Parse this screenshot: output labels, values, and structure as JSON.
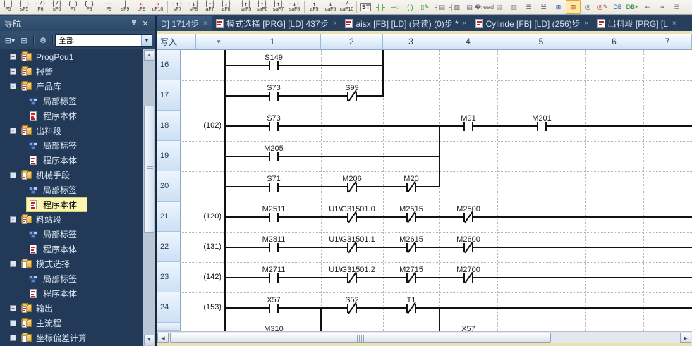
{
  "toolbar": {
    "groups": [
      [
        {
          "sym": "┤ ├",
          "label": "F5"
        },
        {
          "sym": "┤ ├",
          "label": "sF5"
        },
        {
          "sym": "┤/├",
          "label": "F6"
        },
        {
          "sym": "┤/├",
          "label": "sF6"
        },
        {
          "sym": "( )",
          "label": "F7"
        },
        {
          "sym": "{ }",
          "label": "F8"
        }
      ],
      [
        {
          "sym": "──",
          "label": "F9"
        },
        {
          "sym": "│",
          "label": "sF9"
        },
        {
          "sym": "✕",
          "label": "cF9",
          "red": true
        },
        {
          "sym": "✕",
          "label": "cF10",
          "red": true
        }
      ],
      [
        {
          "sym": "┤↑├",
          "label": "sF7"
        },
        {
          "sym": "┤↓├",
          "label": "sF8"
        },
        {
          "sym": "┤↑├",
          "label": "aF7"
        },
        {
          "sym": "┤↓├",
          "label": "aF8"
        }
      ],
      [
        {
          "sym": "┤↑├",
          "label": "saF5"
        },
        {
          "sym": "┤↑├",
          "label": "saF6"
        },
        {
          "sym": "┤↑├",
          "label": "saF7"
        },
        {
          "sym": "┤↓├",
          "label": "saF8"
        }
      ],
      [
        {
          "sym": "↑",
          "label": "aF5"
        },
        {
          "sym": "↓",
          "label": "caF5"
        },
        {
          "sym": "─/─",
          "label": "caF10"
        }
      ]
    ],
    "icons": [
      {
        "name": "st-editor-icon",
        "glyph": "ST",
        "boxed": true
      },
      {
        "name": "edit-contact-icon",
        "glyph": "┤├",
        "color": "#2e8b2e"
      },
      {
        "name": "edit-branch-icon",
        "glyph": "─○",
        "color": "#2e8b2e"
      },
      {
        "name": "edit-coil-icon",
        "glyph": "( )",
        "color": "#2e8b2e"
      },
      {
        "name": "edit-block-icon",
        "glyph": "▯✎",
        "color": "#2e8b2e"
      },
      {
        "name": "device-comment-icon",
        "glyph": "┤▤",
        "color": "#667"
      },
      {
        "name": "note-edit-icon",
        "glyph": "┤▥",
        "color": "#667"
      },
      {
        "name": "statement-icon",
        "glyph": "▤",
        "color": "#667"
      },
      {
        "name": "doc-read-icon",
        "glyph": "�read",
        "color": "#667"
      },
      {
        "name": "find-doc-icon",
        "glyph": "▤",
        "color": "#889"
      },
      {
        "name": "find-doc2-icon",
        "glyph": "▥",
        "color": "#889"
      },
      {
        "name": "insert-line-icon",
        "glyph": "☰",
        "color": "#667"
      },
      {
        "name": "delete-line-icon",
        "glyph": "☱",
        "color": "#667"
      },
      {
        "name": "tree-expand-icon",
        "glyph": "⊞",
        "color": "#3a5aa0"
      },
      {
        "name": "tree-wrap-icon",
        "glyph": "⊟",
        "color": "#c04020",
        "highlighted": true
      },
      {
        "name": "device-find-icon",
        "glyph": "◎",
        "color": "#556"
      },
      {
        "name": "device-replace-icon",
        "glyph": "◎✎",
        "color": "#a03030"
      },
      {
        "name": "dbw-find-icon",
        "glyph": "DB",
        "color": "#2060a0"
      },
      {
        "name": "dbw-sync-icon",
        "glyph": "DB+",
        "color": "#208040"
      },
      {
        "name": "outdent-icon",
        "glyph": "⇤",
        "color": "#667"
      },
      {
        "name": "indent-icon",
        "glyph": "⇥",
        "color": "#667"
      },
      {
        "name": "list-icon",
        "glyph": "☰",
        "color": "#889"
      }
    ]
  },
  "tabs": [
    {
      "label": "D] 1714步",
      "icon": false,
      "active": true
    },
    {
      "label": "模式选择 [PRG] [LD] 437步",
      "icon": true,
      "active": false
    },
    {
      "label": "aisx [FB] [LD] (只读) (0)步 *",
      "icon": true,
      "active": false
    },
    {
      "label": "Cylinde [FB] [LD] (256)步",
      "icon": true,
      "active": false
    },
    {
      "label": "出料段 [PRG] [L",
      "icon": true,
      "active": false
    }
  ],
  "nav": {
    "title": "导航",
    "filter_value": "全部",
    "tree": [
      {
        "level": 1,
        "expand": "+",
        "icon": "folder-ladder",
        "label": "ProgPou1"
      },
      {
        "level": 1,
        "expand": "+",
        "icon": "folder-ladder",
        "label": "报警"
      },
      {
        "level": 1,
        "expand": "-",
        "icon": "folder-ladder",
        "label": "产品库"
      },
      {
        "level": 2,
        "expand": "",
        "icon": "local-label",
        "label": "局部标签"
      },
      {
        "level": 2,
        "expand": "",
        "icon": "program-body",
        "label": "程序本体"
      },
      {
        "level": 1,
        "expand": "-",
        "icon": "folder-ladder",
        "label": "出料段"
      },
      {
        "level": 2,
        "expand": "",
        "icon": "local-label",
        "label": "局部标签"
      },
      {
        "level": 2,
        "expand": "",
        "icon": "program-body",
        "label": "程序本体"
      },
      {
        "level": 1,
        "expand": "-",
        "icon": "folder-ladder",
        "label": "机械手段"
      },
      {
        "level": 2,
        "expand": "",
        "icon": "local-label",
        "label": "局部标签"
      },
      {
        "level": 2,
        "expand": "",
        "icon": "program-body",
        "label": "程序本体",
        "selected": true
      },
      {
        "level": 1,
        "expand": "-",
        "icon": "folder-ladder",
        "label": "料站段"
      },
      {
        "level": 2,
        "expand": "",
        "icon": "local-label",
        "label": "局部标签"
      },
      {
        "level": 2,
        "expand": "",
        "icon": "program-body",
        "label": "程序本体"
      },
      {
        "level": 1,
        "expand": "-",
        "icon": "folder-ladder",
        "label": "模式选择"
      },
      {
        "level": 2,
        "expand": "",
        "icon": "local-label",
        "label": "局部标签"
      },
      {
        "level": 2,
        "expand": "",
        "icon": "program-body",
        "label": "程序本体"
      },
      {
        "level": 1,
        "expand": "+",
        "icon": "folder-ladder",
        "label": "输出"
      },
      {
        "level": 1,
        "expand": "+",
        "icon": "folder-ladder",
        "label": "主流程"
      },
      {
        "level": 1,
        "expand": "+",
        "icon": "folder-ladder",
        "label": "坐标偏差计算"
      }
    ]
  },
  "editor": {
    "mode_label": "写入",
    "columns": [
      "1",
      "2",
      "3",
      "4",
      "5",
      "6",
      "7"
    ],
    "rows": [
      {
        "num": "16",
        "step": "",
        "wire_to_b": 2,
        "contacts": [
          {
            "col": 1,
            "label": "S149",
            "type": "no"
          }
        ]
      },
      {
        "num": "17",
        "step": "",
        "wire_to_b": 2,
        "contacts": [
          {
            "col": 1,
            "label": "S73",
            "type": "no"
          },
          {
            "col": 2,
            "label": "S99",
            "type": "nc"
          }
        ]
      },
      {
        "num": "18",
        "step": "(102)",
        "wire_to_b": "end",
        "contacts": [
          {
            "col": 1,
            "label": "S73",
            "type": "no"
          },
          {
            "col": 4,
            "label": "M91",
            "type": "no"
          },
          {
            "col": 5,
            "label": "M201",
            "type": "no"
          }
        ]
      },
      {
        "num": "19",
        "step": "",
        "wire_to_b": 3,
        "contacts": [
          {
            "col": 1,
            "label": "M205",
            "type": "no"
          }
        ]
      },
      {
        "num": "20",
        "step": "",
        "wire_to_b": 3,
        "contacts": [
          {
            "col": 1,
            "label": "S71",
            "type": "no"
          },
          {
            "col": 2,
            "label": "M206",
            "type": "nc"
          },
          {
            "col": 3,
            "label": "M20",
            "type": "nc"
          }
        ]
      },
      {
        "num": "21",
        "step": "(120)",
        "wire_to_b": "end",
        "contacts": [
          {
            "col": 1,
            "label": "M2511",
            "type": "no"
          },
          {
            "col": 2,
            "label": "U1\\G31501.0",
            "type": "nc"
          },
          {
            "col": 3,
            "label": "M2515",
            "type": "nc"
          },
          {
            "col": 4,
            "label": "M2500",
            "type": "nc"
          }
        ]
      },
      {
        "num": "22",
        "step": "(131)",
        "wire_to_b": "end",
        "contacts": [
          {
            "col": 1,
            "label": "M2811",
            "type": "no"
          },
          {
            "col": 2,
            "label": "U1\\G31501.1",
            "type": "nc"
          },
          {
            "col": 3,
            "label": "M2615",
            "type": "nc"
          },
          {
            "col": 4,
            "label": "M2600",
            "type": "nc"
          }
        ]
      },
      {
        "num": "23",
        "step": "(142)",
        "wire_to_b": "end",
        "contacts": [
          {
            "col": 1,
            "label": "M2711",
            "type": "no"
          },
          {
            "col": 2,
            "label": "U1\\G31501.2",
            "type": "nc"
          },
          {
            "col": 3,
            "label": "M2715",
            "type": "nc"
          },
          {
            "col": 4,
            "label": "M2700",
            "type": "nc"
          }
        ]
      },
      {
        "num": "24",
        "step": "(153)",
        "wire_to_b": "end",
        "contacts": [
          {
            "col": 1,
            "label": "X57",
            "type": "no"
          },
          {
            "col": 2,
            "label": "S52",
            "type": "nc"
          },
          {
            "col": 3,
            "label": "T1",
            "type": "nc"
          }
        ]
      }
    ],
    "verticals": [
      {
        "b": 2,
        "from_row": 16,
        "from_at": "top",
        "to_row": 17,
        "to_at": "wire"
      },
      {
        "b": 3,
        "from_row": 18,
        "from_at": "wire",
        "to_row": 20,
        "to_at": "wire"
      },
      {
        "b": 1,
        "from_row": 24,
        "from_at": "wire",
        "to_at": "bottom"
      },
      {
        "b": 3,
        "from_row": 24,
        "from_at": "wire",
        "to_at": "bottom"
      }
    ],
    "partial_row": {
      "labels": [
        {
          "col": 1,
          "text": "M310"
        },
        {
          "col": 4,
          "text": "X57"
        }
      ]
    }
  },
  "colors": {
    "accent_select": "#fbf6b0",
    "tab_bar": "#273e5c",
    "tree_bg": "#223a58",
    "wire": "#111111"
  }
}
